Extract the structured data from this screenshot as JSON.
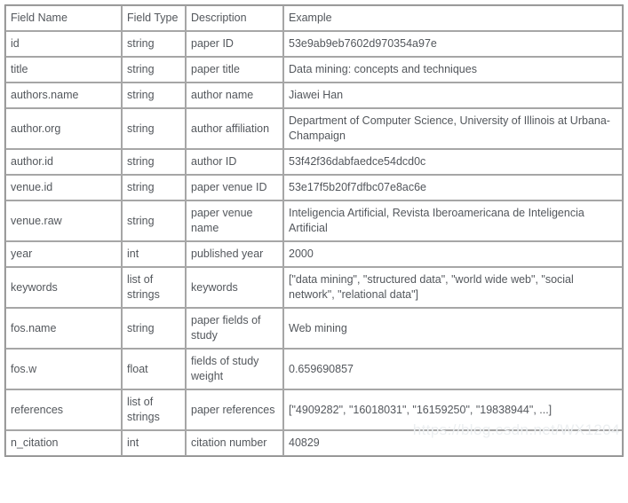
{
  "table": {
    "columns": [
      {
        "key": "field_name",
        "label": "Field Name"
      },
      {
        "key": "field_type",
        "label": "Field Type"
      },
      {
        "key": "description",
        "label": "Description"
      },
      {
        "key": "example",
        "label": "Example"
      }
    ],
    "rows": [
      {
        "field_name": "id",
        "field_type": "string",
        "description": "paper ID",
        "example": "53e9ab9eb7602d970354a97e"
      },
      {
        "field_name": "title",
        "field_type": "string",
        "description": "paper title",
        "example": "Data mining: concepts and techniques"
      },
      {
        "field_name": "authors.name",
        "field_type": "string",
        "description": "author name",
        "example": "Jiawei Han"
      },
      {
        "field_name": "author.org",
        "field_type": "string",
        "description": "author affiliation",
        "example": "Department of Computer Science, University of Illinois at Urbana-Champaign"
      },
      {
        "field_name": "author.id",
        "field_type": "string",
        "description": "author ID",
        "example": "53f42f36dabfaedce54dcd0c"
      },
      {
        "field_name": "venue.id",
        "field_type": "string",
        "description": "paper venue ID",
        "example": "53e17f5b20f7dfbc07e8ac6e"
      },
      {
        "field_name": "venue.raw",
        "field_type": "string",
        "description": "paper venue name",
        "example": "Inteligencia Artificial, Revista Iberoamericana de Inteligencia Artificial"
      },
      {
        "field_name": "year",
        "field_type": "int",
        "description": "published year",
        "example": "2000"
      },
      {
        "field_name": "keywords",
        "field_type": "list of strings",
        "description": "keywords",
        "example": "[\"data mining\", \"structured data\", \"world wide web\", \"social network\", \"relational data\"]"
      },
      {
        "field_name": "fos.name",
        "field_type": "string",
        "description": "paper fields of study",
        "example": "Web mining"
      },
      {
        "field_name": "fos.w",
        "field_type": "float",
        "description": "fields of study weight",
        "example": "0.659690857"
      },
      {
        "field_name": "references",
        "field_type": "list of strings",
        "description": "paper references",
        "example": "[\"4909282\", \"16018031\", \"16159250\",  \"19838944\", ...]"
      },
      {
        "field_name": "n_citation",
        "field_type": "int",
        "description": "citation number",
        "example": "40829"
      }
    ]
  },
  "watermark": {
    "text": "https://blog.csdn.net/WX1204"
  },
  "colors": {
    "text": "#53575c",
    "border_outer": "#8b8b8b",
    "border_cell": "#a6a6a6",
    "background": "#ffffff",
    "watermark": "#eceff1"
  }
}
